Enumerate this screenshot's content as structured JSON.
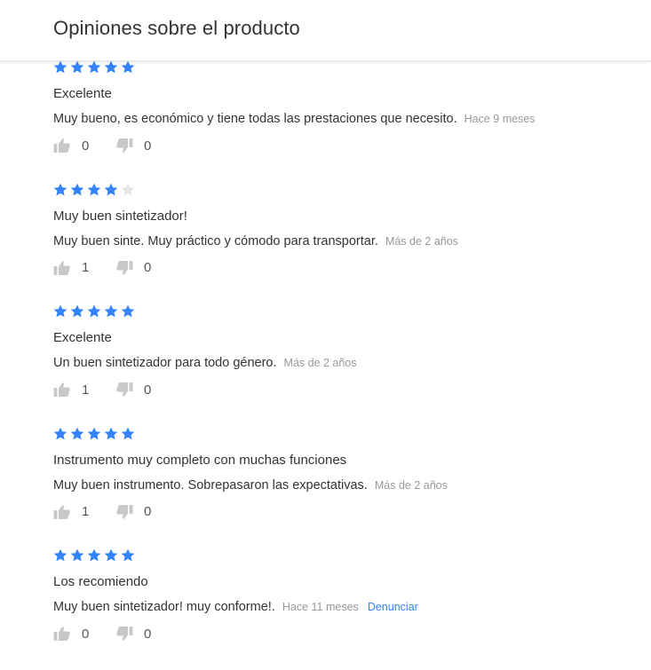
{
  "header": {
    "title": "Opiniones sobre el producto"
  },
  "colors": {
    "star_filled": "#3483fa",
    "star_empty": "#e6e6e6",
    "thumb": "#c8c8c8",
    "link": "#3483fa"
  },
  "reviews": [
    {
      "rating": 5,
      "title": "Excelente",
      "body": "Muy bueno, es económico y tiene todas las prestaciones que necesito.",
      "date": "Hace 9 meses",
      "likes": "0",
      "dislikes": "0",
      "report": ""
    },
    {
      "rating": 4,
      "title": "Muy buen sintetizador!",
      "body": "Muy buen sinte. Muy práctico y cómodo para transportar.",
      "date": "Más de 2 años",
      "likes": "1",
      "dislikes": "0",
      "report": ""
    },
    {
      "rating": 5,
      "title": "Excelente",
      "body": "Un buen sintetizador para todo género.",
      "date": "Más de 2 años",
      "likes": "1",
      "dislikes": "0",
      "report": ""
    },
    {
      "rating": 5,
      "title": "Instrumento muy completo con muchas funciones",
      "body": "Muy buen instrumento. Sobrepasaron las expectativas.",
      "date": "Más de 2 años",
      "likes": "1",
      "dislikes": "0",
      "report": ""
    },
    {
      "rating": 5,
      "title": "Los recomiendo",
      "body": "Muy buen sintetizador! muy conforme!.",
      "date": "Hace 11 meses",
      "likes": "0",
      "dislikes": "0",
      "report": "Denunciar"
    }
  ]
}
